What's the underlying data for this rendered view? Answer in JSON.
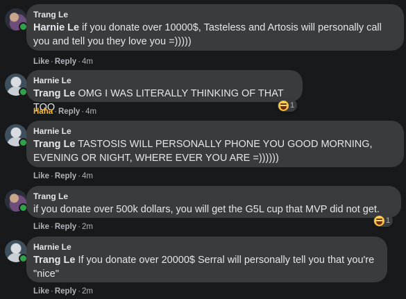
{
  "comments": [
    {
      "author": "Trang Le",
      "mention": "Harnie Le",
      "text": " if you donate over 10000$, Tasteless and Artosis will personally call you and tell you they love you =)))))",
      "reaction_word": "Like",
      "reply": "Reply",
      "separator": "·",
      "time": "4m"
    },
    {
      "author": "Harnie Le",
      "mention": "Trang Le",
      "text": " OMG I WAS LITERALLY THINKING OF THAT TOO",
      "reaction_word": "Haha",
      "reply": "Reply",
      "separator": "·",
      "time": "4m",
      "reaction_count": "1"
    },
    {
      "author": "Harnie Le",
      "mention": "Trang Le",
      "text": " TASTOSIS WILL PERSONALLY PHONE YOU GOOD MORNING, EVENING OR NIGHT, WHERE EVER YOU ARE =))))))",
      "reaction_word": "Like",
      "reply": "Reply",
      "separator": "·",
      "time": "4m"
    },
    {
      "author": "Trang Le",
      "mention": "",
      "text": "if you donate over 500k dollars, you will get the G5L cup that MVP did not get.",
      "reaction_word": "Like",
      "reply": "Reply",
      "separator": "·",
      "time": "2m",
      "reaction_count": "1"
    },
    {
      "author": "Harnie Le",
      "mention": "Trang Le",
      "text": " If you donate over 20000$ Serral will personally tell you that you're \"nice\"",
      "reaction_word": "Like",
      "reply": "Reply",
      "separator": "·",
      "time": "2m"
    }
  ],
  "colors": {
    "background": "#18191a",
    "bubble": "#3a3b3c",
    "text": "#e4e6eb",
    "secondary": "#b0b3b8",
    "haha": "#f7b928",
    "online": "#31a24c"
  },
  "icons": {
    "reaction": "haha-emoji-icon",
    "presence": "online-status-dot"
  }
}
